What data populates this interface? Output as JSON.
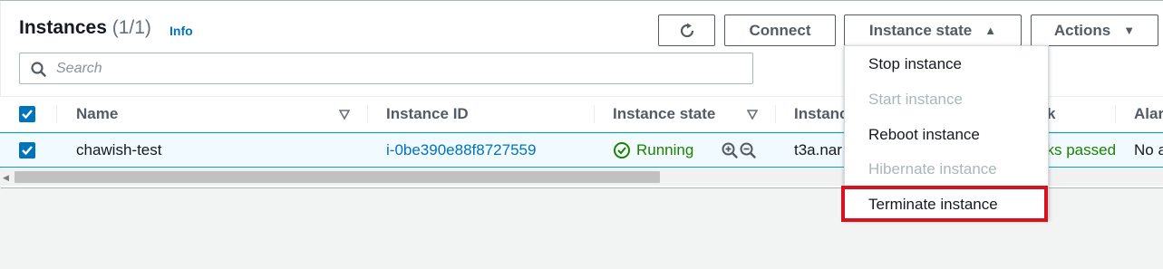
{
  "header": {
    "title": "Instances",
    "count": "(1/1)",
    "info_link": "Info"
  },
  "toolbar": {
    "refresh_icon": "refresh-icon",
    "connect_label": "Connect",
    "instance_state_label": "Instance state",
    "actions_label": "Actions"
  },
  "search": {
    "placeholder": "Search",
    "value": ""
  },
  "table": {
    "columns": [
      {
        "label": "Name"
      },
      {
        "label": "Instance ID"
      },
      {
        "label": "Instance state"
      },
      {
        "label": "Instance"
      },
      {
        "label": "k"
      },
      {
        "label": "Alar"
      }
    ],
    "rows": [
      {
        "name": "chawish-test",
        "instance_id": "i-0be390e88f8727559",
        "state": "Running",
        "type": "t3a.nar",
        "status_check": "cks passed",
        "alarm": "No a"
      }
    ]
  },
  "instance_state_menu": {
    "items": [
      {
        "label": "Stop instance",
        "enabled": true
      },
      {
        "label": "Start instance",
        "enabled": false
      },
      {
        "label": "Reboot instance",
        "enabled": true
      },
      {
        "label": "Hibernate instance",
        "enabled": false
      },
      {
        "label": "Terminate instance",
        "enabled": true
      }
    ]
  },
  "colors": {
    "accent": "#0073bb",
    "running": "#1d8102",
    "highlight": "#d9111c"
  }
}
